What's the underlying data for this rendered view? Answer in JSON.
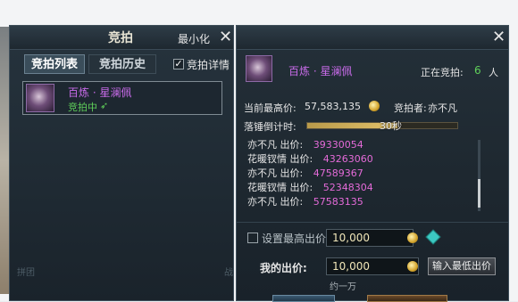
{
  "left_panel": {
    "title": "竞拍",
    "minimize_label": "最小化",
    "close_glyph": "✕",
    "tabs": [
      {
        "label": "竞拍列表",
        "active": true
      },
      {
        "label": "竞拍历史",
        "active": false
      }
    ],
    "detail_checkbox": {
      "label": "竞拍详情",
      "checked": true
    },
    "items": [
      {
        "name": "百炼 · 星澜佩",
        "status": "竞拍中"
      }
    ],
    "faded_text": {
      "line1": "拼团",
      "line2": "战"
    }
  },
  "right_panel": {
    "close_glyph": "✕",
    "item_name": "百炼 · 星澜佩",
    "bidding_label": "正在竞拍:",
    "bidder_count": "6",
    "bidder_unit": "人",
    "current_price_label": "当前最高价:",
    "current_price": "57,583,135",
    "bidder_label": "竞拍者:",
    "bidder_name": "亦不凡",
    "countdown_label": "落锤倒计时:",
    "countdown_value": "30秒",
    "countdown_fraction": 0.6,
    "history": [
      {
        "name": "亦不凡",
        "label": "出价:",
        "amount": "39330054"
      },
      {
        "name": "花暖钗情",
        "label": "出价:",
        "amount": "43263060"
      },
      {
        "name": "亦不凡",
        "label": "出价:",
        "amount": "47589367"
      },
      {
        "name": "花暖钗情",
        "label": "出价:",
        "amount": "52348304"
      },
      {
        "name": "亦不凡",
        "label": "出价:",
        "amount": "57583135"
      }
    ],
    "max_bid": {
      "label": "设置最高出价",
      "value": "10,000"
    },
    "my_bid": {
      "label": "我的出价:",
      "value": "10,000",
      "hint": "约一万"
    },
    "min_bid_button": "输入最低出价"
  },
  "colors": {
    "purple": "#c76be8",
    "green": "#5fcf5a",
    "pink": "#e56bd9"
  }
}
